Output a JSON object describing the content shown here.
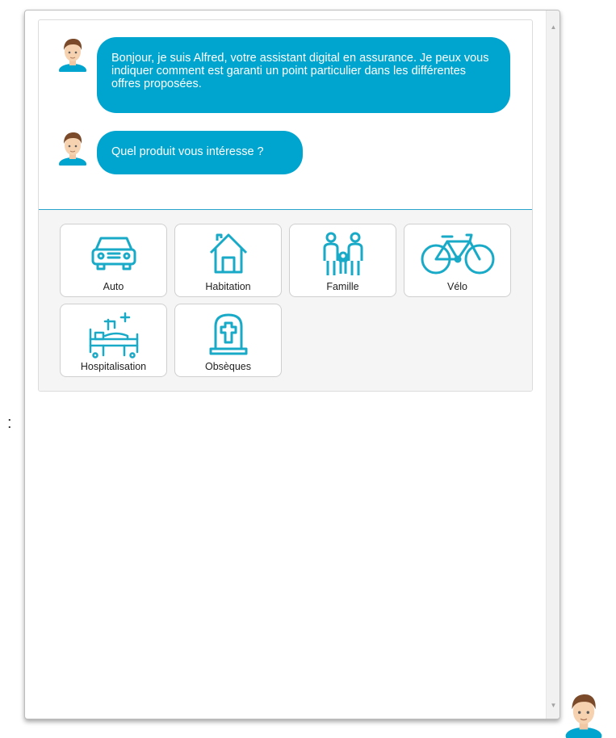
{
  "stray_text": ":",
  "chat": {
    "messages": [
      {
        "author": "Alfred",
        "text": "Bonjour, je suis Alfred, votre assistant digital en assurance. Je peux vous indiquer comment est garanti un point particulier dans les différentes offres proposées."
      },
      {
        "author": "Alfred",
        "text": "Quel produit vous intéresse ?"
      }
    ],
    "choices": [
      {
        "label": "Auto",
        "icon": "car-icon"
      },
      {
        "label": "Habitation",
        "icon": "house-icon"
      },
      {
        "label": "Famille",
        "icon": "family-icon"
      },
      {
        "label": "Vélo",
        "icon": "bicycle-icon"
      },
      {
        "label": "Hospitalisation",
        "icon": "hospital-bed-icon"
      },
      {
        "label": "Obsèques",
        "icon": "tombstone-icon"
      }
    ]
  },
  "colors": {
    "accent": "#00a5cf",
    "bubble_text": "#ffffff",
    "divider": "#2aa3cc",
    "choices_bg": "#f5f5f5"
  }
}
